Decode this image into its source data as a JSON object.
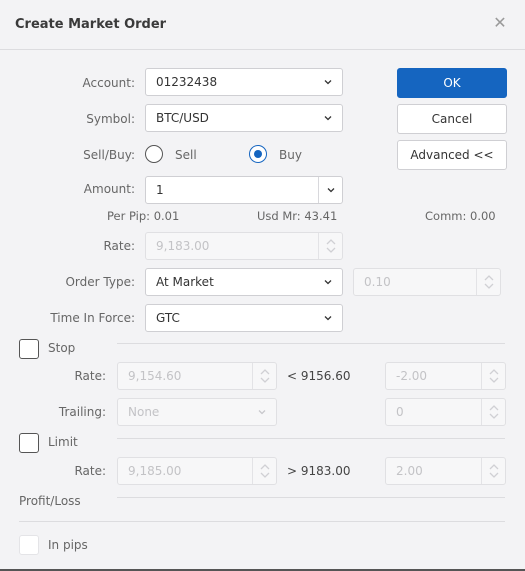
{
  "dialog": {
    "title": "Create Market Order",
    "close_icon": "close-icon"
  },
  "buttons": {
    "ok": "OK",
    "cancel": "Cancel",
    "advanced": "Advanced <<"
  },
  "form": {
    "account": {
      "label": "Account:",
      "value": "01232438"
    },
    "symbol": {
      "label": "Symbol:",
      "value": "BTC/USD"
    },
    "sell_buy": {
      "label": "Sell/Buy:",
      "options": [
        {
          "label": "Sell",
          "checked": false
        },
        {
          "label": "Buy",
          "checked": true
        }
      ]
    },
    "amount": {
      "label": "Amount:",
      "value": "1"
    },
    "info": {
      "per_pip": "Per Pip: 0.01",
      "usd_mr": "Usd Mr: 43.41",
      "comm": "Comm: 0.00"
    },
    "rate": {
      "label": "Rate:",
      "value": "9,183.00"
    },
    "order_type": {
      "label": "Order Type:",
      "value": "At Market",
      "range_value": "0.10"
    },
    "time_in_force": {
      "label": "Time In Force:",
      "value": "GTC"
    }
  },
  "stop": {
    "label": "Stop",
    "checked": false,
    "rate_label": "Rate:",
    "rate_value": "9,154.60",
    "condition": "< 9156.60",
    "pips_value": "-2.00",
    "trailing_label": "Trailing:",
    "trailing_value": "None",
    "trailing_pips": "0"
  },
  "limit": {
    "label": "Limit",
    "checked": false,
    "rate_label": "Rate:",
    "rate_value": "9,185.00",
    "condition": "> 9183.00",
    "pips_value": "2.00"
  },
  "profit_loss": {
    "label": "Profit/Loss"
  },
  "in_pips": {
    "label": "In pips",
    "checked": false
  }
}
